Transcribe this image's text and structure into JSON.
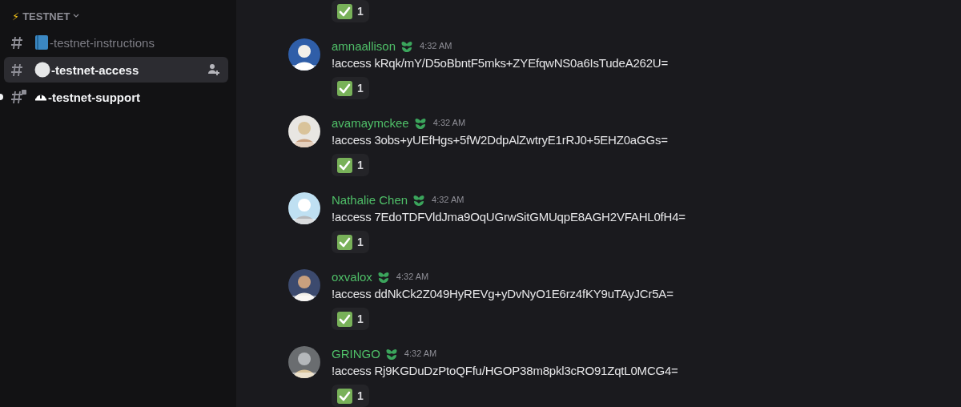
{
  "sidebar": {
    "category": {
      "icon": "⚡",
      "label": "TESTNET",
      "expanded": true
    },
    "channels": [
      {
        "kind": "book",
        "name": "-testnet-instructions",
        "selected": false,
        "unread": false,
        "locked": false
      },
      {
        "kind": "circle",
        "name": "-testnet-access",
        "selected": true,
        "unread": false,
        "locked": false
      },
      {
        "kind": "helmet",
        "name": "-testnet-support",
        "selected": false,
        "unread": true,
        "locked": true
      }
    ]
  },
  "top_reaction": {
    "count": "1"
  },
  "messages": [
    {
      "author": "amnaallison",
      "time": "4:32 AM",
      "text": "!access kRqk/mY/D5oBbntF5mks+ZYEfqwNS0a6IsTudeA262U=",
      "reaction": {
        "count": "1"
      }
    },
    {
      "author": "avamaymckee",
      "time": "4:32 AM",
      "text": "!access 3obs+yUEfHgs+5fW2DdpAlZwtryE1rRJ0+5EHZ0aGGs=",
      "reaction": {
        "count": "1"
      }
    },
    {
      "author": "Nathalie Chen",
      "time": "4:32 AM",
      "text": "!access 7EdoTDFVldJma9OqUGrwSitGMUqpE8AGH2VFAHL0fH4=",
      "reaction": {
        "count": "1"
      }
    },
    {
      "author": "oxvalox",
      "time": "4:32 AM",
      "text": "!access ddNkCk2Z049HyREVg+yDvNyO1E6rz4fKY9uTAyJCr5A=",
      "reaction": {
        "count": "1"
      }
    },
    {
      "author": "GRINGO",
      "time": "4:32 AM",
      "text": "!access Rj9KGDuDzPtoQFfu/HGOP38m8pkl3cRO91ZqtL0MCG4=",
      "reaction": {
        "count": "1"
      }
    }
  ]
}
